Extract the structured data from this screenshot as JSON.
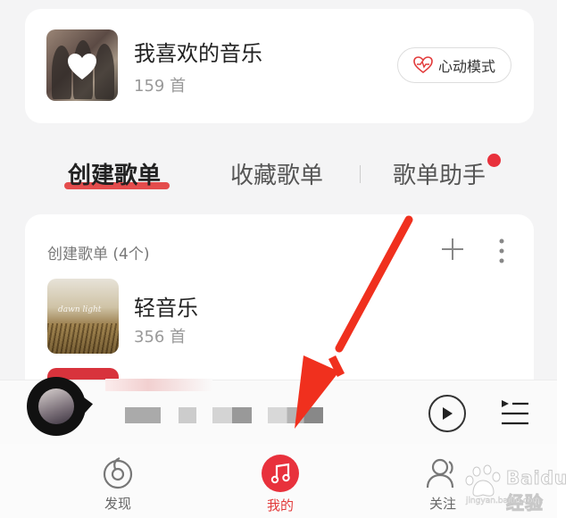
{
  "favorite": {
    "title": "我喜欢的音乐",
    "count": "159 首",
    "heart_mode_label": "心动模式"
  },
  "tabs": {
    "created": "创建歌单",
    "collected": "收藏歌单",
    "assistant": "歌单助手"
  },
  "playlists": {
    "header": "创建歌单 (4个)",
    "items": [
      {
        "title": "轻音乐",
        "count": "356 首"
      }
    ]
  },
  "bottom_nav": {
    "items": [
      {
        "label": "发现",
        "icon": "discover-icon"
      },
      {
        "label": "我的",
        "icon": "music-note-icon"
      },
      {
        "label": "关注",
        "icon": "follow-icon"
      }
    ]
  },
  "watermark": {
    "text": "Baidu经验",
    "url": "jingyan.baidu.com"
  },
  "colors": {
    "accent": "#e23a3a",
    "badge": "#e8313c",
    "arrow": "#f0301e"
  }
}
